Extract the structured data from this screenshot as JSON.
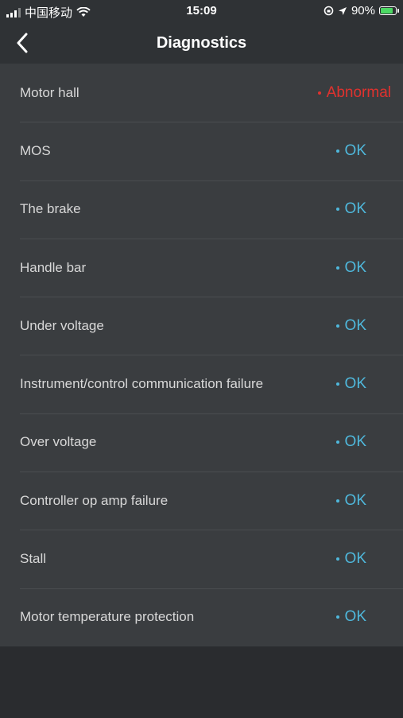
{
  "status_bar": {
    "carrier": "中国移动",
    "time": "15:09",
    "battery": "90%"
  },
  "nav": {
    "title": "Diagnostics"
  },
  "colors": {
    "ok": "#4fb8dc",
    "abnormal": "#e0322e"
  },
  "items": [
    {
      "label": "Motor hall",
      "status": "Abnormal",
      "state": "abnormal"
    },
    {
      "label": "MOS",
      "status": "OK",
      "state": "ok"
    },
    {
      "label": "The brake",
      "status": "OK",
      "state": "ok"
    },
    {
      "label": "Handle bar",
      "status": "OK",
      "state": "ok"
    },
    {
      "label": "Under voltage",
      "status": "OK",
      "state": "ok"
    },
    {
      "label": "Instrument/control communication failure",
      "status": "OK",
      "state": "ok"
    },
    {
      "label": "Over voltage",
      "status": "OK",
      "state": "ok"
    },
    {
      "label": "Controller op amp failure",
      "status": "OK",
      "state": "ok"
    },
    {
      "label": "Stall",
      "status": "OK",
      "state": "ok"
    },
    {
      "label": "Motor temperature protection",
      "status": "OK",
      "state": "ok"
    }
  ]
}
